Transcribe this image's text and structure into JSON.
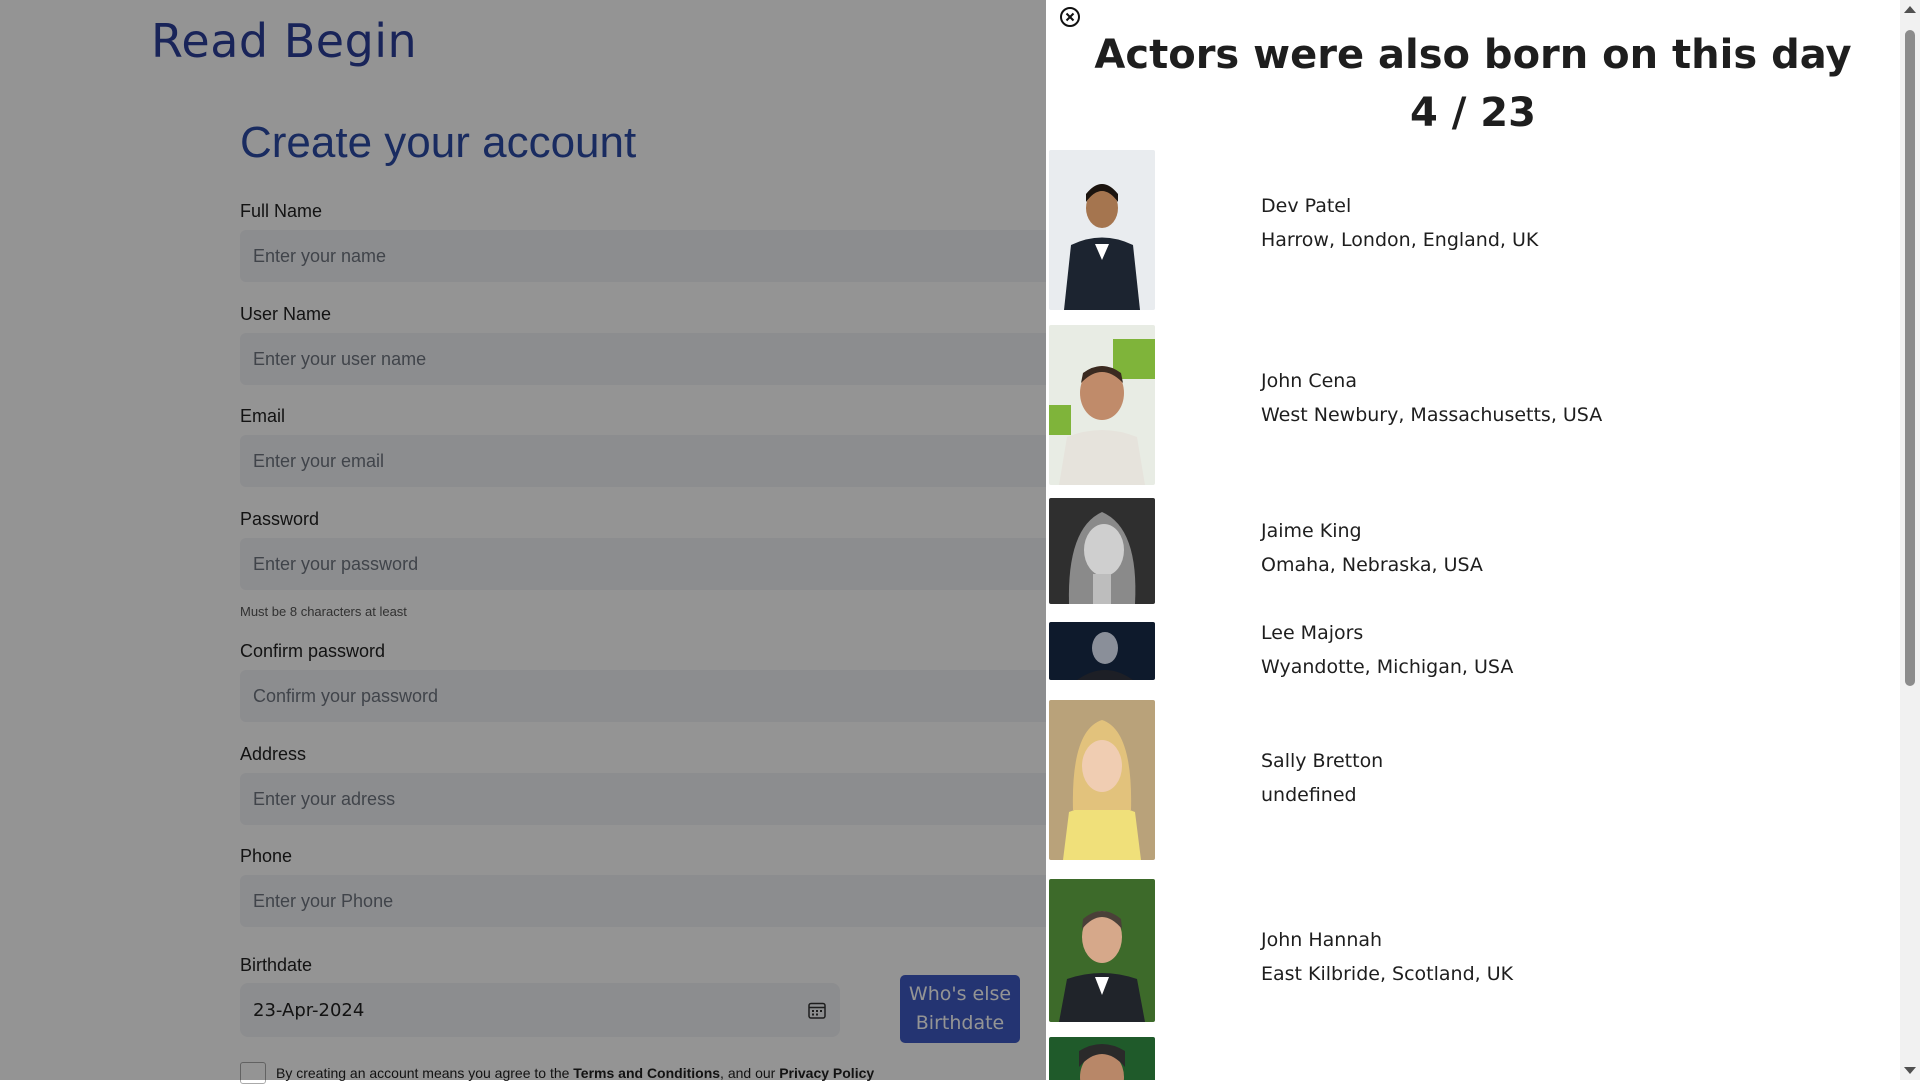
{
  "logo": "Read Begin",
  "form": {
    "title": "Create your account",
    "fields": [
      {
        "label": "Full Name",
        "placeholder": "Enter your name"
      },
      {
        "label": "User Name",
        "placeholder": "Enter your user name"
      },
      {
        "label": "Email",
        "placeholder": "Enter your email"
      },
      {
        "label": "Password",
        "placeholder": "Enter your password"
      },
      {
        "label": "Confirm password",
        "placeholder": "Confirm your password"
      },
      {
        "label": "Address",
        "placeholder": "Enter your adress"
      },
      {
        "label": "Phone",
        "placeholder": "Enter your Phone"
      }
    ],
    "password_hint": "Must be 8 characters at least",
    "birthdate": {
      "label": "Birthdate",
      "value": "23-Apr-2024",
      "icon": "calendar-icon"
    },
    "who_else_button": "Who's else Birthdate",
    "terms": {
      "prefix": "By creating an account means you agree to the",
      "terms_link": "Terms and Conditions",
      "middle": ", and our",
      "privacy_link": "Privacy Policy"
    }
  },
  "drawer": {
    "close_icon": "close-circle-icon",
    "title": "Actors were also born on this day",
    "date": "4 / 23",
    "actors": [
      {
        "name": "Dev Patel",
        "place": "Harrow, London, England, UK",
        "photo_colors": [
          "#e9ecef",
          "#1c2430"
        ]
      },
      {
        "name": "John Cena",
        "place": "West Newbury, Massachusetts, USA",
        "photo_colors": [
          "#7fb43a",
          "#e6e3dc"
        ]
      },
      {
        "name": "Jaime King",
        "place": "Omaha, Nebraska, USA",
        "photo_colors": [
          "#2f2f2f",
          "#cfcfcf"
        ]
      },
      {
        "name": "Lee Majors",
        "place": "Wyandotte, Michigan, USA",
        "photo_colors": [
          "#0e1a2c",
          "#8a8f99"
        ]
      },
      {
        "name": "Sally Bretton",
        "place": "undefined",
        "photo_colors": [
          "#b9a27a",
          "#f0e07a"
        ]
      },
      {
        "name": "John Hannah",
        "place": "East Kilbride, Scotland, UK",
        "photo_colors": [
          "#3d6a2a",
          "#20242a"
        ]
      },
      {
        "name": "",
        "place": "",
        "photo_colors": [
          "#1f5a2a",
          "#2a2a2a"
        ]
      }
    ]
  },
  "colors": {
    "accent": "#3f5bc4",
    "title": "#2b4aa6",
    "logo": "#2b3f9a"
  }
}
